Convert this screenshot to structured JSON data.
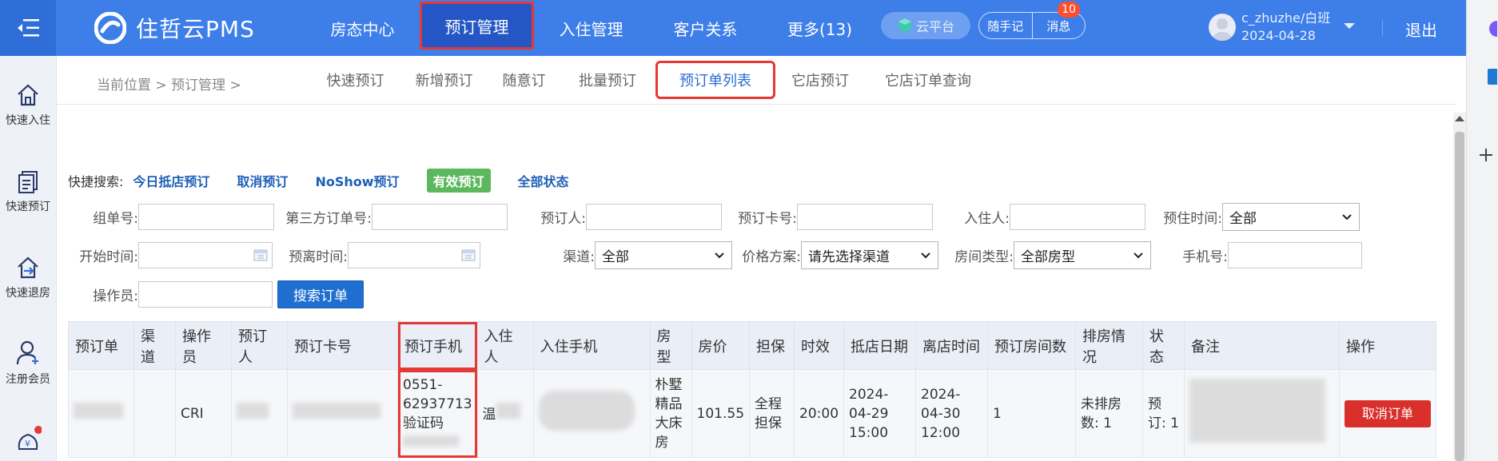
{
  "app": {
    "name": "住哲云PMS"
  },
  "nav": [
    {
      "label": "房态中心"
    },
    {
      "label": "预订管理"
    },
    {
      "label": "入住管理"
    },
    {
      "label": "客户关系"
    },
    {
      "label": "更多(13)"
    }
  ],
  "header": {
    "cloud": "云平台",
    "notes": "随手记",
    "messages": "消息",
    "message_count": "10",
    "user": "c_zhuzhe/白班",
    "date": "2024-04-28",
    "logout": "退出"
  },
  "sidebar": [
    {
      "label": "快速入住",
      "icon": "home-icon"
    },
    {
      "label": "快速预订",
      "icon": "document-icon"
    },
    {
      "label": "快速退房",
      "icon": "checkout-icon"
    },
    {
      "label": "注册会员",
      "icon": "add-user-icon"
    },
    {
      "label": "",
      "icon": "money-bag-icon"
    }
  ],
  "breadcrumb": {
    "text": "当前位置 > 预订管理 >"
  },
  "subtabs": [
    {
      "label": "快速预订"
    },
    {
      "label": "新增预订"
    },
    {
      "label": "随意订"
    },
    {
      "label": "批量预订"
    },
    {
      "label": "预订单列表"
    },
    {
      "label": "它店预订"
    },
    {
      "label": "它店订单查询"
    }
  ],
  "quick_search": {
    "label": "快捷搜索:",
    "items": [
      "今日抵店预订",
      "取消预订",
      "NoShow预订",
      "有效预订",
      "全部状态"
    ],
    "active": "有效预订"
  },
  "filters": {
    "group_no": "组单号:",
    "third_party_no": "第三方订单号:",
    "booker": "预订人:",
    "booking_card": "预订卡号:",
    "guest": "入住人:",
    "stay_time": "预住时间:",
    "stay_time_value": "全部",
    "start_time": "开始时间:",
    "departure_time": "预离时间:",
    "channel": "渠道:",
    "channel_value": "全部",
    "price_plan": "价格方案:",
    "price_plan_value": "请先选择渠道",
    "room_type": "房间类型:",
    "room_type_value": "全部房型",
    "phone": "手机号:",
    "operator": "操作员:",
    "search_button": "搜索订单"
  },
  "table": {
    "columns": [
      "预订单",
      "渠道",
      "操作员",
      "预订人",
      "预订卡号",
      "预订手机",
      "入住人",
      "入住手机",
      "房型",
      "房价",
      "担保",
      "时效",
      "抵店日期",
      "离店时间",
      "预订房间数",
      "排房情况",
      "状态",
      "备注",
      "操作"
    ],
    "rows": [
      {
        "operator": "CRI",
        "phone_line1": "0551-",
        "phone_line2": "62937713",
        "phone_line3": "验证码",
        "guest_fragment": "温",
        "room_type": "朴墅精品大床房",
        "price": "101.55",
        "guarantee": "全程担保",
        "validity": "20:00",
        "arrival": "2024-04-29 15:00",
        "departure": "2024-04-30 12:00",
        "rooms": "1",
        "assign": "未排房数: 1",
        "status": "预订: 1",
        "action": "取消订单"
      }
    ]
  }
}
